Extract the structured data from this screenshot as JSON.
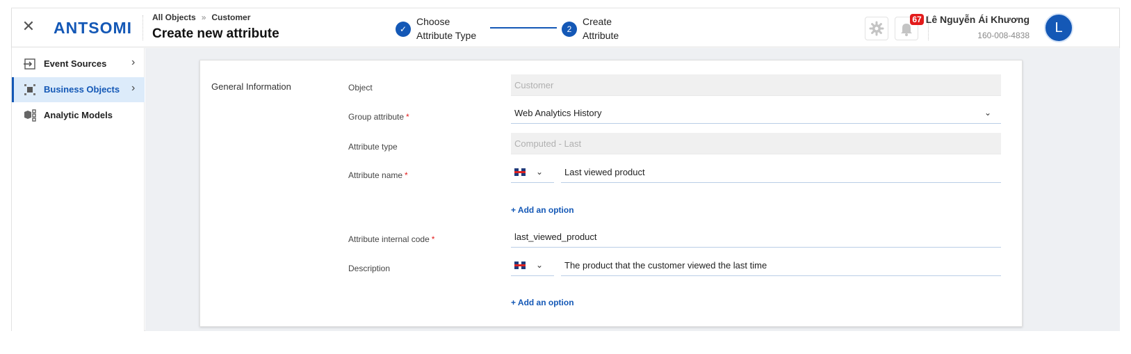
{
  "header": {
    "close_icon": "close-icon",
    "logo_text": "ANTSOMI",
    "breadcrumb": {
      "root": "All Objects",
      "separator": "»",
      "current": "Customer"
    },
    "title": "Create new attribute",
    "steps": [
      {
        "number": "✓",
        "label_line1": "Choose",
        "label_line2": "Attribute Type",
        "status": "done"
      },
      {
        "number": "2",
        "label_line1": "Create",
        "label_line2": "Attribute",
        "status": "active"
      }
    ],
    "notification_count": "67",
    "user": {
      "name": "Lê Nguyễn Ái Khương",
      "phone": "160-008-4838",
      "initial": "L"
    }
  },
  "sidebar": {
    "items": [
      {
        "label": "Event Sources",
        "icon": "import-icon",
        "active": false,
        "has_chevron": true
      },
      {
        "label": "Business Objects",
        "icon": "objects-icon",
        "active": true,
        "has_chevron": true
      },
      {
        "label": "Analytic Models",
        "icon": "models-icon",
        "active": false,
        "has_chevron": false
      }
    ]
  },
  "form": {
    "section_title": "General Information",
    "required_mark": "*",
    "fields": {
      "object": {
        "label": "Object",
        "value": "Customer"
      },
      "group_attribute": {
        "label": "Group attribute",
        "value": "Web Analytics History"
      },
      "attribute_type": {
        "label": "Attribute type",
        "value": "Computed - Last"
      },
      "attribute_name": {
        "label": "Attribute name",
        "value": "Last viewed product"
      },
      "internal_code": {
        "label": "Attribute internal code",
        "value": "last_viewed_product"
      },
      "description": {
        "label": "Description",
        "value": "The product that the customer viewed the last time"
      }
    },
    "add_option_label": "+ Add an option"
  },
  "colors": {
    "primary": "#1458b6",
    "badge": "#e31b1b",
    "active_bg": "#dcebfa"
  }
}
